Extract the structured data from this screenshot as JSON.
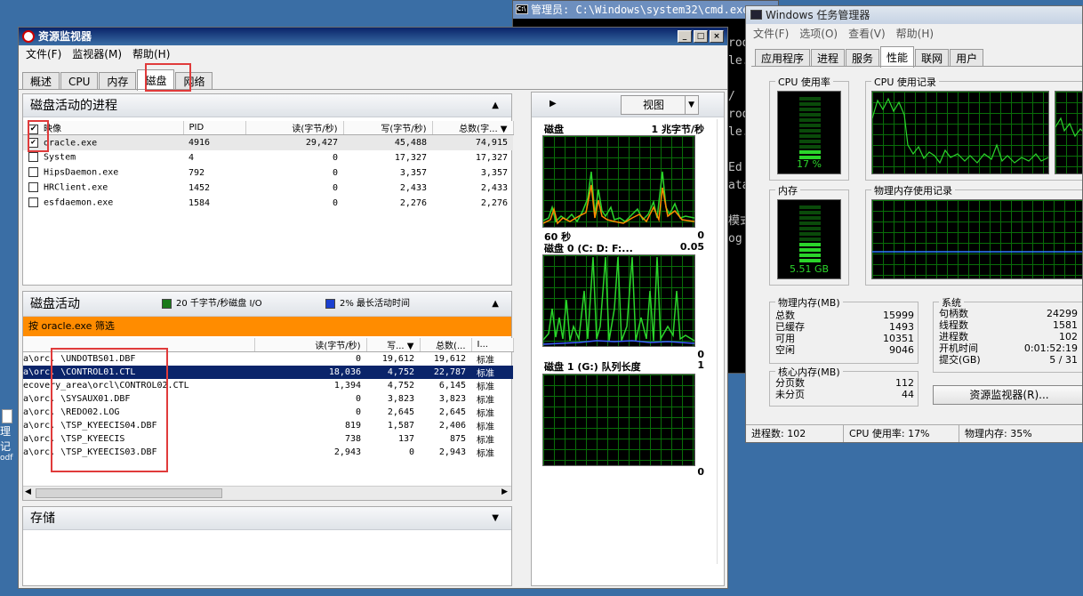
{
  "cmd": {
    "title": "管理员: C:\\Windows\\system32\\cmd.exe",
    "lines": [
      "rod",
      "le.",
      "",
      "/",
      "rod",
      "le.",
      "",
      "Ed",
      "ata",
      "",
      "模式",
      "og"
    ]
  },
  "desktop_icon": {
    "label_line1": "理记",
    "label_line2": "odf"
  },
  "resmon": {
    "title": "资源监视器",
    "menus": [
      "文件(F)",
      "监视器(M)",
      "帮助(H)"
    ],
    "tabs": [
      "概述",
      "CPU",
      "内存",
      "磁盘",
      "网络"
    ],
    "active_tab": "磁盘",
    "proc_panel": {
      "title": "磁盘活动的进程",
      "columns": [
        "映像",
        "PID",
        "读(字节/秒)",
        "写(字节/秒)",
        "总数(字..."
      ],
      "rows": [
        {
          "checked": true,
          "image": "oracle.exe",
          "pid": "4916",
          "read": "29,427",
          "write": "45,488",
          "total": "74,915"
        },
        {
          "checked": false,
          "image": "System",
          "pid": "4",
          "read": "0",
          "write": "17,327",
          "total": "17,327"
        },
        {
          "checked": false,
          "image": "HipsDaemon.exe",
          "pid": "792",
          "read": "0",
          "write": "3,357",
          "total": "3,357"
        },
        {
          "checked": false,
          "image": "HRClient.exe",
          "pid": "1452",
          "read": "0",
          "write": "2,433",
          "total": "2,433"
        },
        {
          "checked": false,
          "image": "esfdaemon.exe",
          "pid": "1584",
          "read": "0",
          "write": "2,276",
          "total": "2,276"
        }
      ]
    },
    "disk_panel": {
      "title": "磁盘活动",
      "legend1": "20 千字节/秒磁盘 I/O",
      "legend2": "2% 最长活动时间",
      "legend1_color": "#1a7a1a",
      "legend2_color": "#1a3fd0",
      "filter": "按 oracle.exe 筛选",
      "columns": [
        "读(字节/秒)",
        "写...",
        "总数(...",
        "I..."
      ],
      "rows": [
        {
          "file": "a\\orc. \\UNDOTBS01.DBF",
          "read": "0",
          "write": "19,612",
          "total": "19,612",
          "prio": "标准",
          "sel": false
        },
        {
          "file": "a\\orc. \\CONTROL01.CTL",
          "read": "18,036",
          "write": "4,752",
          "total": "22,787",
          "prio": "标准",
          "sel": true
        },
        {
          "file": "ecovery_area\\orcl\\CONTROL02.CTL",
          "read": "1,394",
          "write": "4,752",
          "total": "6,145",
          "prio": "标准",
          "sel": false
        },
        {
          "file": "a\\orc. \\SYSAUX01.DBF",
          "read": "0",
          "write": "3,823",
          "total": "3,823",
          "prio": "标准",
          "sel": false
        },
        {
          "file": "a\\orc. \\REDO02.LOG",
          "read": "0",
          "write": "2,645",
          "total": "2,645",
          "prio": "标准",
          "sel": false
        },
        {
          "file": "a\\orc. \\TSP_KYEECIS04.DBF",
          "read": "819",
          "write": "1,587",
          "total": "2,406",
          "prio": "标准",
          "sel": false
        },
        {
          "file": "a\\orc. \\TSP_KYEECIS",
          "read": "738",
          "write": "137",
          "total": "875",
          "prio": "标准",
          "sel": false
        },
        {
          "file": "a\\orc. \\TSP_KYEECIS03.DBF",
          "read": "2,943",
          "write": "0",
          "total": "2,943",
          "prio": "标准",
          "sel": false
        }
      ]
    },
    "storage_panel": {
      "title": "存储"
    },
    "graphs": {
      "view_label": "视图",
      "g1_title": "磁盘",
      "g1_scale": "1 兆字节/秒",
      "g1_time": "60 秒",
      "g1_min": "0",
      "g2_title": "磁盘 0 (C: D: F:...",
      "g2_scale": "0.05",
      "g2_min": "0",
      "g3_title": "磁盘 1 (G:) 队列长度",
      "g3_scale": "1",
      "g3_min": "0"
    }
  },
  "taskmgr": {
    "title": "Windows 任务管理器",
    "menus": [
      "文件(F)",
      "选项(O)",
      "查看(V)",
      "帮助(H)"
    ],
    "tabs": [
      "应用程序",
      "进程",
      "服务",
      "性能",
      "联网",
      "用户"
    ],
    "active_tab": "性能",
    "cpu_usage_label": "CPU 使用率",
    "cpu_usage_value": "17 %",
    "cpu_history_label": "CPU 使用记录",
    "mem_label": "内存",
    "mem_value": "5.51 GB",
    "mem_history_label": "物理内存使用记录",
    "phys_mem": {
      "title": "物理内存(MB)",
      "rows": [
        [
          "总数",
          "15999"
        ],
        [
          "已缓存",
          "1493"
        ],
        [
          "可用",
          "10351"
        ],
        [
          "空闲",
          "9046"
        ]
      ]
    },
    "system": {
      "title": "系统",
      "rows": [
        [
          "句柄数",
          "24299"
        ],
        [
          "线程数",
          "1581"
        ],
        [
          "进程数",
          "102"
        ],
        [
          "开机时间",
          "0:01:52:19"
        ],
        [
          "提交(GB)",
          "5 / 31"
        ]
      ]
    },
    "kernel_mem": {
      "title": "核心内存(MB)",
      "rows": [
        [
          "分页数",
          "112"
        ],
        [
          "未分页",
          "44"
        ]
      ]
    },
    "resmon_button": "资源监视器(R)...",
    "status": {
      "procs": "进程数: 102",
      "cpu": "CPU 使用率: 17%",
      "mem": "物理内存: 35%"
    }
  }
}
